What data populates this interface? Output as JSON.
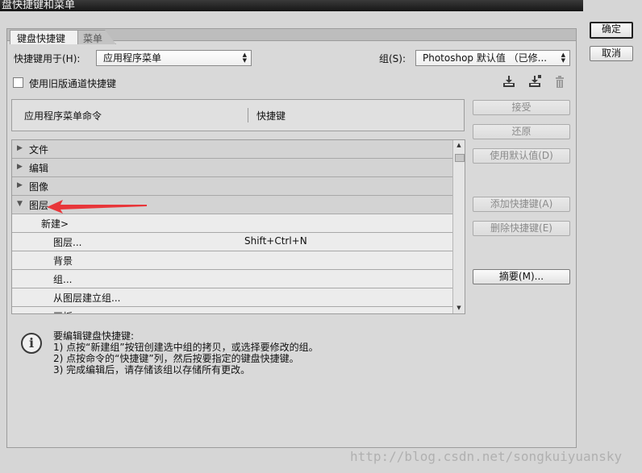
{
  "window": {
    "title": "盘快捷键和菜单"
  },
  "tabs": [
    {
      "label": "键盘快捷键"
    },
    {
      "label": "菜单"
    }
  ],
  "controls": {
    "shortcuts_for_label": "快捷键用于(H):",
    "shortcuts_for_value": "应用程序菜单",
    "set_label": "组(S):",
    "set_value": "Photoshop 默认值 （已修...",
    "legacy_checkbox_label": "使用旧版通道快捷键",
    "legacy_checked": false
  },
  "toolbar_icons": [
    "save-set-icon",
    "save-set-as-icon",
    "trash-icon"
  ],
  "list": {
    "col_command": "应用程序菜单命令",
    "col_shortcut": "快捷键",
    "rows": [
      {
        "name": "文件",
        "shortcut": ""
      },
      {
        "name": "编辑",
        "shortcut": ""
      },
      {
        "name": "图像",
        "shortcut": ""
      },
      {
        "name": "图层",
        "shortcut": ""
      },
      {
        "name": "新建>",
        "shortcut": ""
      },
      {
        "name": "图层...",
        "shortcut": "Shift+Ctrl+N"
      },
      {
        "name": "背景",
        "shortcut": ""
      },
      {
        "name": "组...",
        "shortcut": ""
      },
      {
        "name": "从图层建立组...",
        "shortcut": ""
      },
      {
        "name": "画板",
        "shortcut": ""
      }
    ]
  },
  "side_buttons": {
    "accept": "接受",
    "undo": "还原",
    "use_default": "使用默认值(D)",
    "add_shortcut": "添加快捷键(A)",
    "delete_shortcut": "删除快捷键(E)",
    "summarize": "摘要(M)..."
  },
  "dialog_buttons": {
    "ok": "确定",
    "cancel": "取消"
  },
  "info": {
    "line1": "要编辑键盘快捷键:",
    "line2": "1) 点按“新建组”按钮创建选中组的拷贝，或选择要修改的组。",
    "line3": "2) 点按命令的“快捷键”列，然后按要指定的键盘快捷键。",
    "line4": "3) 完成编辑后，请存储该组以存储所有更改。"
  },
  "annotation": {
    "arrow_color": "#e8363a"
  },
  "watermark": "http://blog.csdn.net/songkuiyuansky"
}
